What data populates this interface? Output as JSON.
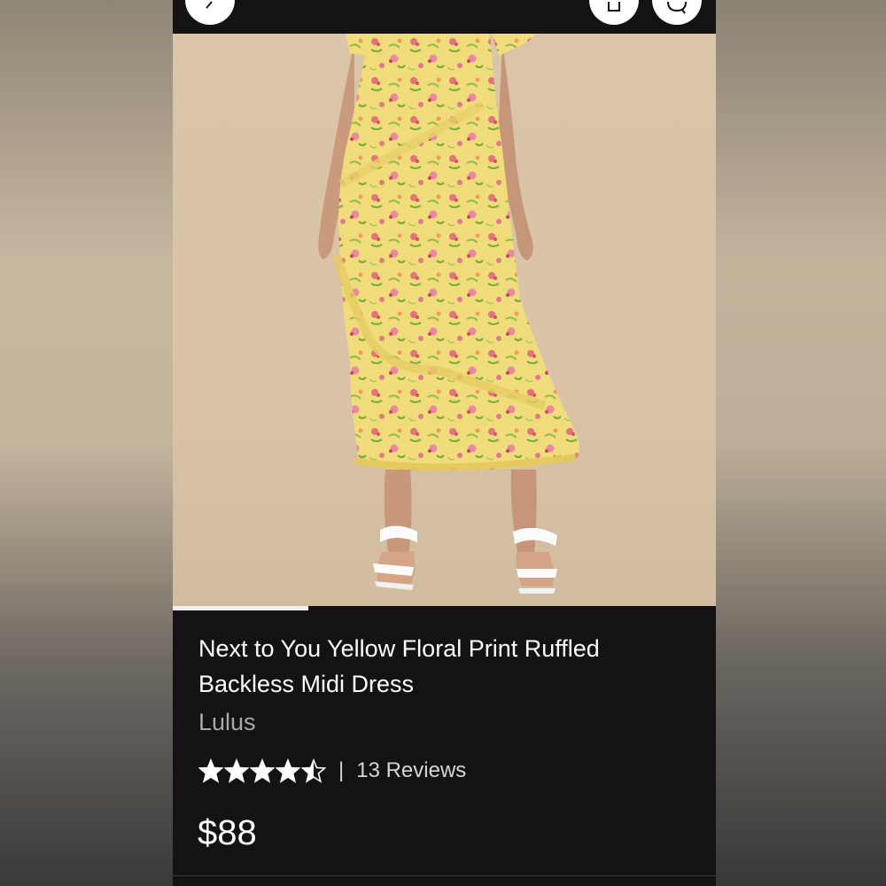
{
  "product": {
    "title": "Next to You Yellow Floral Print Ruffled Backless Midi Dress",
    "brand": "Lulus",
    "rating": 4.5,
    "rating_max": 5,
    "separator": "|",
    "reviews_label": "13 Reviews",
    "price": "$88"
  },
  "gallery": {
    "progress_fraction": 0.25
  },
  "icons": {
    "back": "chevron-left-icon",
    "share": "share-icon",
    "chat": "chat-icon",
    "star": "star-icon"
  },
  "colors": {
    "background": "#141214",
    "text_primary": "#ffffff",
    "text_secondary": "#a9a7a8",
    "dress_yellow": "#f1dc7c"
  }
}
